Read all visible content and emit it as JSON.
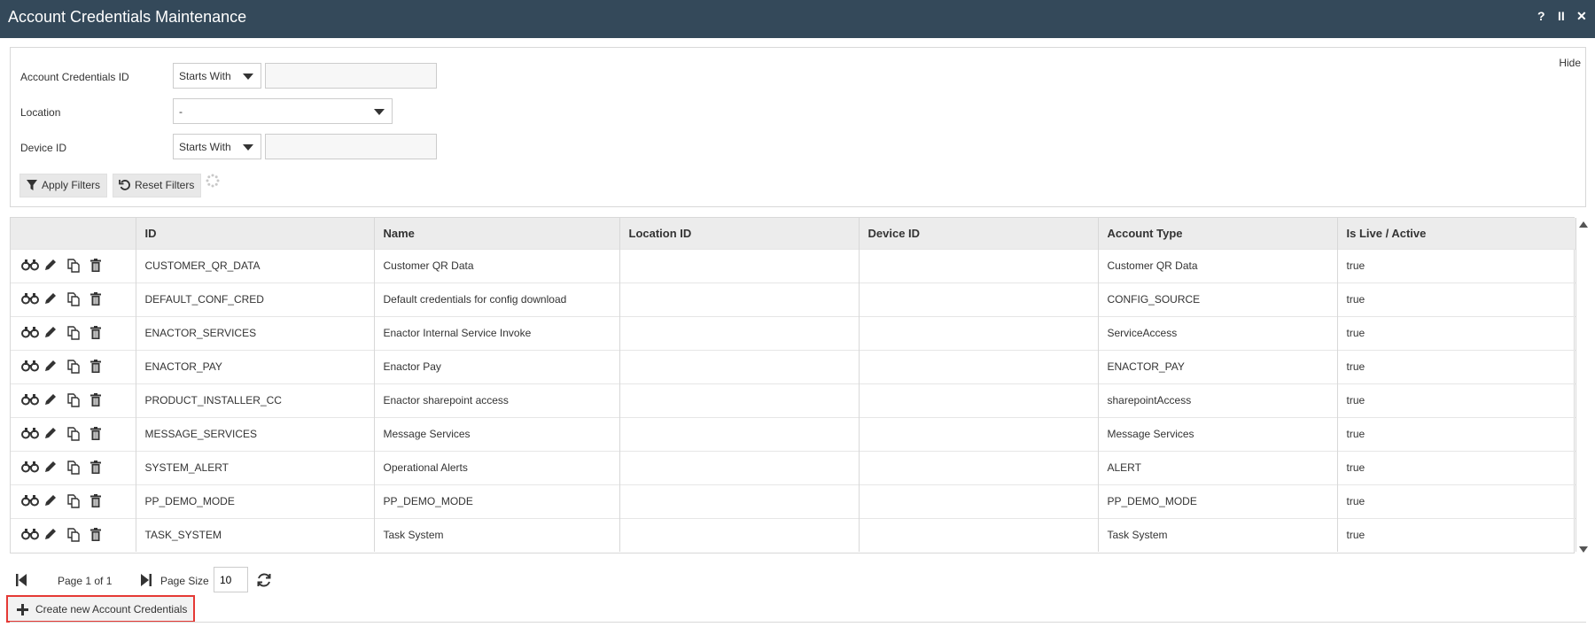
{
  "window": {
    "title": "Account Credentials Maintenance",
    "help": "?",
    "pause": "II",
    "close": "✕"
  },
  "filters": {
    "hide_label": "Hide",
    "account_id": {
      "label": "Account Credentials ID",
      "mode": "Starts With",
      "value": ""
    },
    "location": {
      "label": "Location",
      "value": "-"
    },
    "device_id": {
      "label": "Device ID",
      "mode": "Starts With",
      "value": ""
    },
    "apply_label": "Apply Filters",
    "reset_label": "Reset Filters"
  },
  "grid": {
    "columns": [
      "",
      "ID",
      "Name",
      "Location ID",
      "Device ID",
      "Account Type",
      "Is Live / Active"
    ],
    "rows": [
      [
        "CUSTOMER_QR_DATA",
        "Customer QR Data",
        "",
        "",
        "Customer QR Data",
        "true"
      ],
      [
        "DEFAULT_CONF_CRED",
        "Default credentials for config download",
        "",
        "",
        "CONFIG_SOURCE",
        "true"
      ],
      [
        "ENACTOR_SERVICES",
        "Enactor Internal Service Invoke",
        "",
        "",
        "ServiceAccess",
        "true"
      ],
      [
        "ENACTOR_PAY",
        "Enactor Pay",
        "",
        "",
        "ENACTOR_PAY",
        "true"
      ],
      [
        "PRODUCT_INSTALLER_CC",
        "Enactor sharepoint access",
        "",
        "",
        "sharepointAccess",
        "true"
      ],
      [
        "MESSAGE_SERVICES",
        "Message Services",
        "",
        "",
        "Message Services",
        "true"
      ],
      [
        "SYSTEM_ALERT",
        "Operational Alerts",
        "",
        "",
        "ALERT",
        "true"
      ],
      [
        "PP_DEMO_MODE",
        "PP_DEMO_MODE",
        "",
        "",
        "PP_DEMO_MODE",
        "true"
      ],
      [
        "TASK_SYSTEM",
        "Task System",
        "",
        "",
        "Task System",
        "true"
      ]
    ]
  },
  "pager": {
    "page_text": "Page 1 of 1",
    "page_size_label": "Page Size",
    "page_size": "10"
  },
  "create_label": "Create new Account Credentials",
  "colors": {
    "titlebar": "#34495a",
    "highlight": "#e53935"
  }
}
